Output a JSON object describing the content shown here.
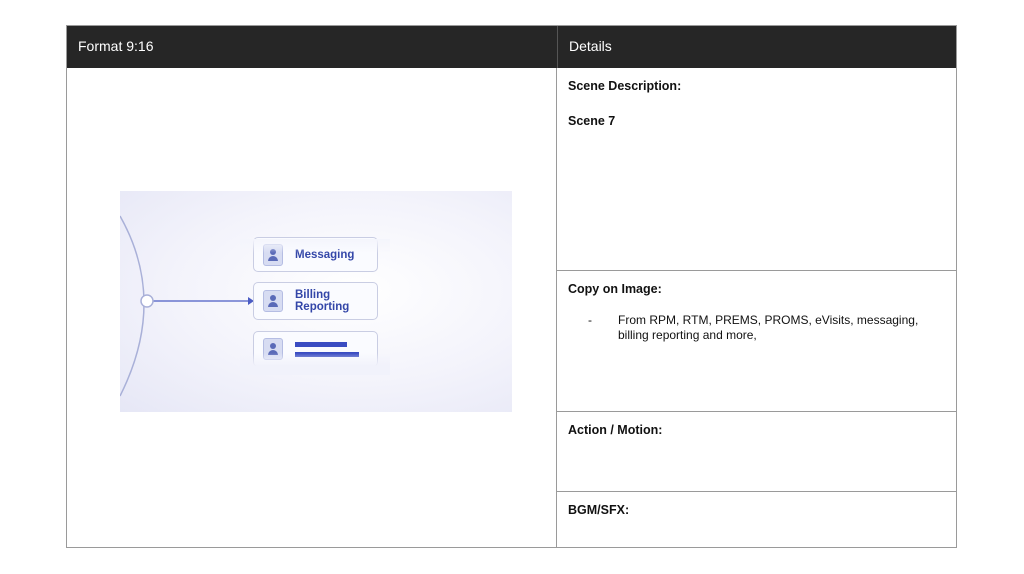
{
  "header": {
    "left_title": "Format 9:16",
    "right_title": "Details"
  },
  "image": {
    "pills": [
      {
        "label": "Messaging",
        "icon": "user-icon"
      },
      {
        "label_line1": "Billing",
        "label_line2": "Reporting",
        "icon": "user-icon"
      },
      {
        "label": "",
        "icon": "user-icon"
      }
    ],
    "accent": "#3a4cc2"
  },
  "details": {
    "scene_description_label": "Scene Description:",
    "scene_value": "Scene 7",
    "copy_on_image_label": "Copy on Image:",
    "copy_dash": "-",
    "copy_text": "From RPM, RTM, PREMS, PROMS, eVisits, messaging, billing reporting and more,",
    "action_motion_label": "Action / Motion:",
    "bgm_sfx_label": "BGM/SFX:"
  }
}
